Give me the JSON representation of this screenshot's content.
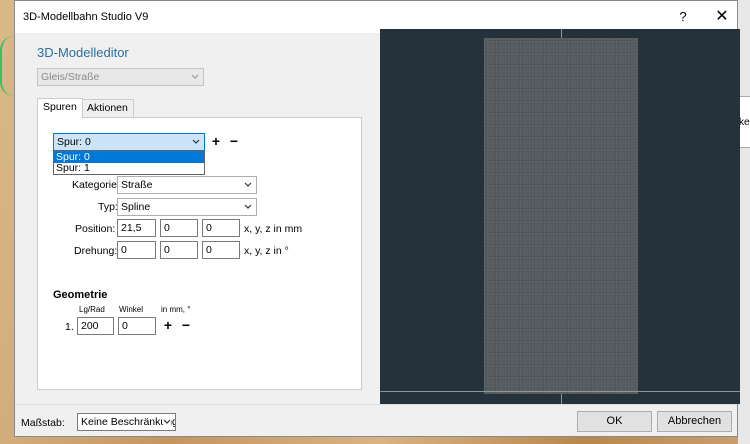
{
  "window": {
    "title": "3D-Modellbahn Studio V9",
    "help_glyph": "?",
    "close_glyph": "✕"
  },
  "editor": {
    "heading": "3D-Modelleditor",
    "object_type": "Gleis/Straße"
  },
  "tabs": [
    {
      "label": "Spuren",
      "active": true
    },
    {
      "label": "Aktionen",
      "active": false
    }
  ],
  "spur": {
    "selected": "Spur: 0",
    "options": [
      {
        "label": "Spur: 0",
        "highlighted": true
      },
      {
        "label": "Spur: 1",
        "highlighted": false
      }
    ],
    "add_glyph": "+",
    "remove_glyph": "−"
  },
  "kategorie": {
    "label": "Kategorie:",
    "value": "Straße"
  },
  "typ": {
    "label": "Typ:",
    "value": "Spline"
  },
  "position": {
    "label": "Position:",
    "x": "21,5",
    "y": "0",
    "z": "0",
    "unit": "x, y, z in mm"
  },
  "drehung": {
    "label": "Drehung:",
    "x": "0",
    "y": "0",
    "z": "0",
    "unit": "x, y, z in °"
  },
  "geometrie": {
    "heading": "Geometrie",
    "col_lg": "Lg/Rad",
    "col_winkel": "Winkel",
    "col_unit": "in mm, °",
    "rows": [
      {
        "index": "1.",
        "lg": "200",
        "winkel": "0"
      }
    ],
    "add_glyph": "+",
    "remove_glyph": "−"
  },
  "footer": {
    "massstab_label": "Maßstab:",
    "massstab_value": "Keine Beschränkung",
    "ok": "OK",
    "cancel": "Abbrechen"
  },
  "background": {
    "partial_text": "ke"
  },
  "colors": {
    "accent": "#2e6e9e",
    "preview_bg": "#25313b",
    "road": "#555b5e",
    "highlight": "#0078d7"
  }
}
